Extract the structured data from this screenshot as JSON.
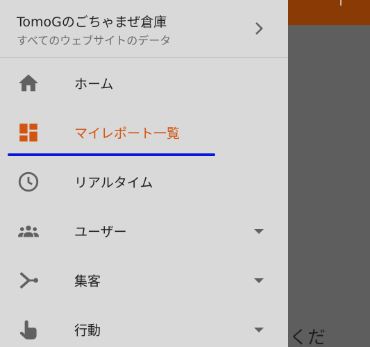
{
  "colors": {
    "accent": "#d2540f",
    "drawer_bg": "#d9d9d9",
    "overlay": "#5e5e5e",
    "appbar": "#8a3a05",
    "underline": "#0a17d6",
    "icon": "#616161"
  },
  "account": {
    "title": "TomoGのごちゃまぜ倉庫",
    "subtitle": "すべてのウェブサイトのデータ",
    "chevron_icon": "chevron-right-icon"
  },
  "nav": {
    "items": [
      {
        "label": "ホーム",
        "icon": "home-icon",
        "active": false,
        "expandable": false
      },
      {
        "label": "マイレポート一覧",
        "icon": "dashboard-icon",
        "active": true,
        "expandable": false
      },
      {
        "label": "リアルタイム",
        "icon": "clock-icon",
        "active": false,
        "expandable": false
      },
      {
        "label": "ユーザー",
        "icon": "people-icon",
        "active": false,
        "expandable": true
      },
      {
        "label": "集客",
        "icon": "merge-icon",
        "active": false,
        "expandable": true
      },
      {
        "label": "行動",
        "icon": "touch-icon",
        "active": false,
        "expandable": true
      }
    ]
  },
  "background": {
    "visible_text": "くだ"
  }
}
